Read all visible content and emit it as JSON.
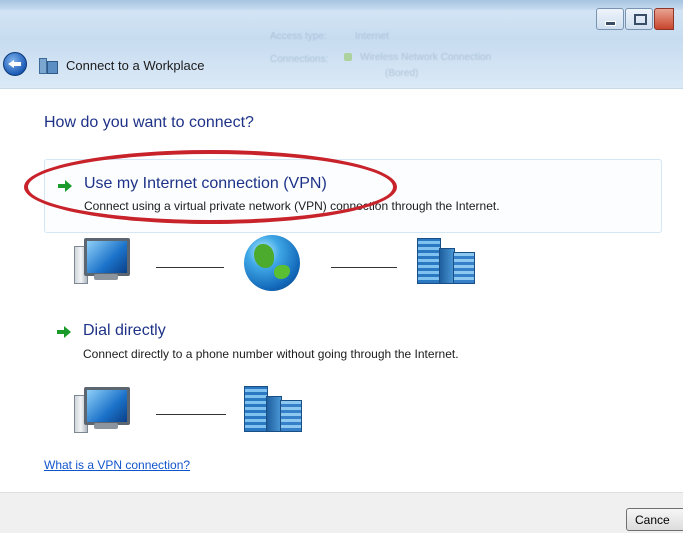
{
  "window": {
    "title": "Connect to a Workplace",
    "background_rows": [
      {
        "label": "Access type:",
        "value": "Internet"
      },
      {
        "label": "Connections:",
        "value": "Wireless Network Connection",
        "sub": "(Bored)"
      }
    ]
  },
  "prompt": "How do you want to connect?",
  "options": [
    {
      "title": "Use my Internet connection (VPN)",
      "description": "Connect using a virtual private network (VPN) connection through the Internet.",
      "icon": "green-arrow-icon",
      "highlighted": true
    },
    {
      "title": "Dial directly",
      "description": "Connect directly to a phone number without going through the Internet.",
      "icon": "green-arrow-icon",
      "highlighted": false
    }
  ],
  "help_link": "What is a VPN connection?",
  "footer": {
    "cancel_label": "Cance"
  },
  "colors": {
    "heading_blue": "#1e3287",
    "link_blue": "#1155cc",
    "arrow_green": "#1a9a2a",
    "annotation_red": "#c8222a"
  }
}
